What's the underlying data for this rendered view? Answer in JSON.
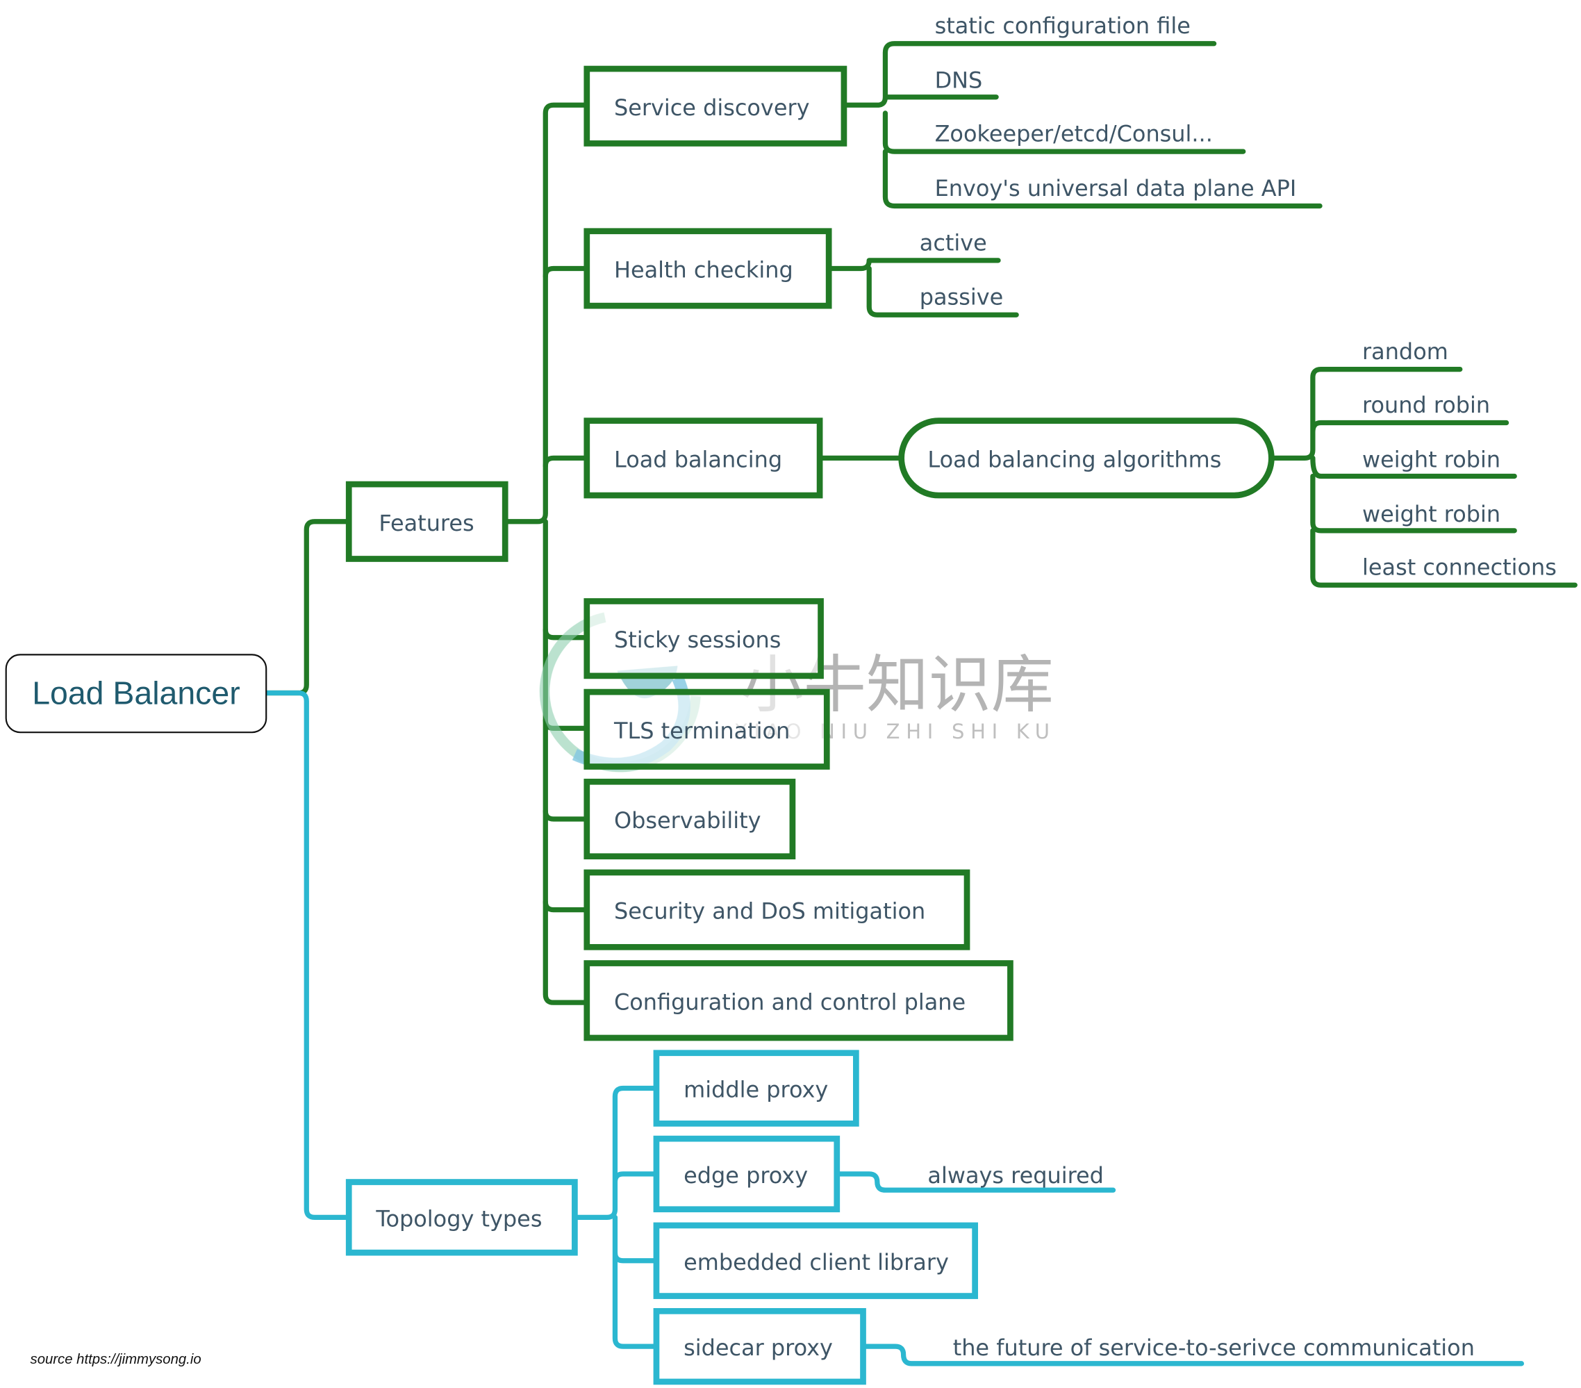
{
  "root": {
    "label": "Load Balancer"
  },
  "colors": {
    "features_branch": "#217a25",
    "topology_branch": "#2bb7d0",
    "text": "#3e5566",
    "root_text": "#1f5a6e"
  },
  "features": {
    "label": "Features",
    "children": [
      {
        "label": "Service discovery",
        "leaves": [
          "static configuration file",
          "DNS",
          "Zookeeper/etcd/Consul...",
          "Envoy's universal data plane API"
        ]
      },
      {
        "label": "Health checking",
        "leaves": [
          "active",
          "passive"
        ]
      },
      {
        "label": "Load balancing",
        "sub": {
          "label": "Load balancing algorithms",
          "leaves": [
            "random",
            "round robin",
            "weight robin",
            "weight robin",
            "least connections"
          ]
        }
      },
      {
        "label": "Sticky sessions"
      },
      {
        "label": "TLS termination"
      },
      {
        "label": "Observability"
      },
      {
        "label": "Security and DoS mitigation"
      },
      {
        "label": "Configuration and control plane"
      }
    ]
  },
  "topology": {
    "label": "Topology types",
    "children": [
      {
        "label": "middle proxy"
      },
      {
        "label": "edge proxy",
        "note": "always required"
      },
      {
        "label": "embedded client library"
      },
      {
        "label": "sidecar proxy",
        "note": "the future of service-to-serivce communication"
      }
    ]
  },
  "source": "source https://jimmysong.io",
  "watermark": {
    "cn": "小牛知识库",
    "en": "XIAO NIU ZHI SHI KU",
    "icon": "bull-logo-icon"
  }
}
